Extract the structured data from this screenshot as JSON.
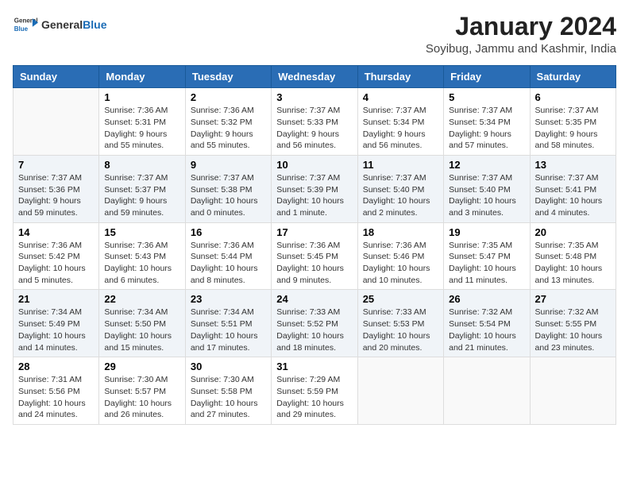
{
  "header": {
    "logo_general": "General",
    "logo_blue": "Blue",
    "month_title": "January 2024",
    "location": "Soyibug, Jammu and Kashmir, India"
  },
  "days_of_week": [
    "Sunday",
    "Monday",
    "Tuesday",
    "Wednesday",
    "Thursday",
    "Friday",
    "Saturday"
  ],
  "weeks": [
    [
      {
        "day": "",
        "info": ""
      },
      {
        "day": "1",
        "info": "Sunrise: 7:36 AM\nSunset: 5:31 PM\nDaylight: 9 hours and 55 minutes."
      },
      {
        "day": "2",
        "info": "Sunrise: 7:36 AM\nSunset: 5:32 PM\nDaylight: 9 hours and 55 minutes."
      },
      {
        "day": "3",
        "info": "Sunrise: 7:37 AM\nSunset: 5:33 PM\nDaylight: 9 hours and 56 minutes."
      },
      {
        "day": "4",
        "info": "Sunrise: 7:37 AM\nSunset: 5:34 PM\nDaylight: 9 hours and 56 minutes."
      },
      {
        "day": "5",
        "info": "Sunrise: 7:37 AM\nSunset: 5:34 PM\nDaylight: 9 hours and 57 minutes."
      },
      {
        "day": "6",
        "info": "Sunrise: 7:37 AM\nSunset: 5:35 PM\nDaylight: 9 hours and 58 minutes."
      }
    ],
    [
      {
        "day": "7",
        "info": "Sunrise: 7:37 AM\nSunset: 5:36 PM\nDaylight: 9 hours and 59 minutes."
      },
      {
        "day": "8",
        "info": "Sunrise: 7:37 AM\nSunset: 5:37 PM\nDaylight: 9 hours and 59 minutes."
      },
      {
        "day": "9",
        "info": "Sunrise: 7:37 AM\nSunset: 5:38 PM\nDaylight: 10 hours and 0 minutes."
      },
      {
        "day": "10",
        "info": "Sunrise: 7:37 AM\nSunset: 5:39 PM\nDaylight: 10 hours and 1 minute."
      },
      {
        "day": "11",
        "info": "Sunrise: 7:37 AM\nSunset: 5:40 PM\nDaylight: 10 hours and 2 minutes."
      },
      {
        "day": "12",
        "info": "Sunrise: 7:37 AM\nSunset: 5:40 PM\nDaylight: 10 hours and 3 minutes."
      },
      {
        "day": "13",
        "info": "Sunrise: 7:37 AM\nSunset: 5:41 PM\nDaylight: 10 hours and 4 minutes."
      }
    ],
    [
      {
        "day": "14",
        "info": "Sunrise: 7:36 AM\nSunset: 5:42 PM\nDaylight: 10 hours and 5 minutes."
      },
      {
        "day": "15",
        "info": "Sunrise: 7:36 AM\nSunset: 5:43 PM\nDaylight: 10 hours and 6 minutes."
      },
      {
        "day": "16",
        "info": "Sunrise: 7:36 AM\nSunset: 5:44 PM\nDaylight: 10 hours and 8 minutes."
      },
      {
        "day": "17",
        "info": "Sunrise: 7:36 AM\nSunset: 5:45 PM\nDaylight: 10 hours and 9 minutes."
      },
      {
        "day": "18",
        "info": "Sunrise: 7:36 AM\nSunset: 5:46 PM\nDaylight: 10 hours and 10 minutes."
      },
      {
        "day": "19",
        "info": "Sunrise: 7:35 AM\nSunset: 5:47 PM\nDaylight: 10 hours and 11 minutes."
      },
      {
        "day": "20",
        "info": "Sunrise: 7:35 AM\nSunset: 5:48 PM\nDaylight: 10 hours and 13 minutes."
      }
    ],
    [
      {
        "day": "21",
        "info": "Sunrise: 7:34 AM\nSunset: 5:49 PM\nDaylight: 10 hours and 14 minutes."
      },
      {
        "day": "22",
        "info": "Sunrise: 7:34 AM\nSunset: 5:50 PM\nDaylight: 10 hours and 15 minutes."
      },
      {
        "day": "23",
        "info": "Sunrise: 7:34 AM\nSunset: 5:51 PM\nDaylight: 10 hours and 17 minutes."
      },
      {
        "day": "24",
        "info": "Sunrise: 7:33 AM\nSunset: 5:52 PM\nDaylight: 10 hours and 18 minutes."
      },
      {
        "day": "25",
        "info": "Sunrise: 7:33 AM\nSunset: 5:53 PM\nDaylight: 10 hours and 20 minutes."
      },
      {
        "day": "26",
        "info": "Sunrise: 7:32 AM\nSunset: 5:54 PM\nDaylight: 10 hours and 21 minutes."
      },
      {
        "day": "27",
        "info": "Sunrise: 7:32 AM\nSunset: 5:55 PM\nDaylight: 10 hours and 23 minutes."
      }
    ],
    [
      {
        "day": "28",
        "info": "Sunrise: 7:31 AM\nSunset: 5:56 PM\nDaylight: 10 hours and 24 minutes."
      },
      {
        "day": "29",
        "info": "Sunrise: 7:30 AM\nSunset: 5:57 PM\nDaylight: 10 hours and 26 minutes."
      },
      {
        "day": "30",
        "info": "Sunrise: 7:30 AM\nSunset: 5:58 PM\nDaylight: 10 hours and 27 minutes."
      },
      {
        "day": "31",
        "info": "Sunrise: 7:29 AM\nSunset: 5:59 PM\nDaylight: 10 hours and 29 minutes."
      },
      {
        "day": "",
        "info": ""
      },
      {
        "day": "",
        "info": ""
      },
      {
        "day": "",
        "info": ""
      }
    ]
  ]
}
